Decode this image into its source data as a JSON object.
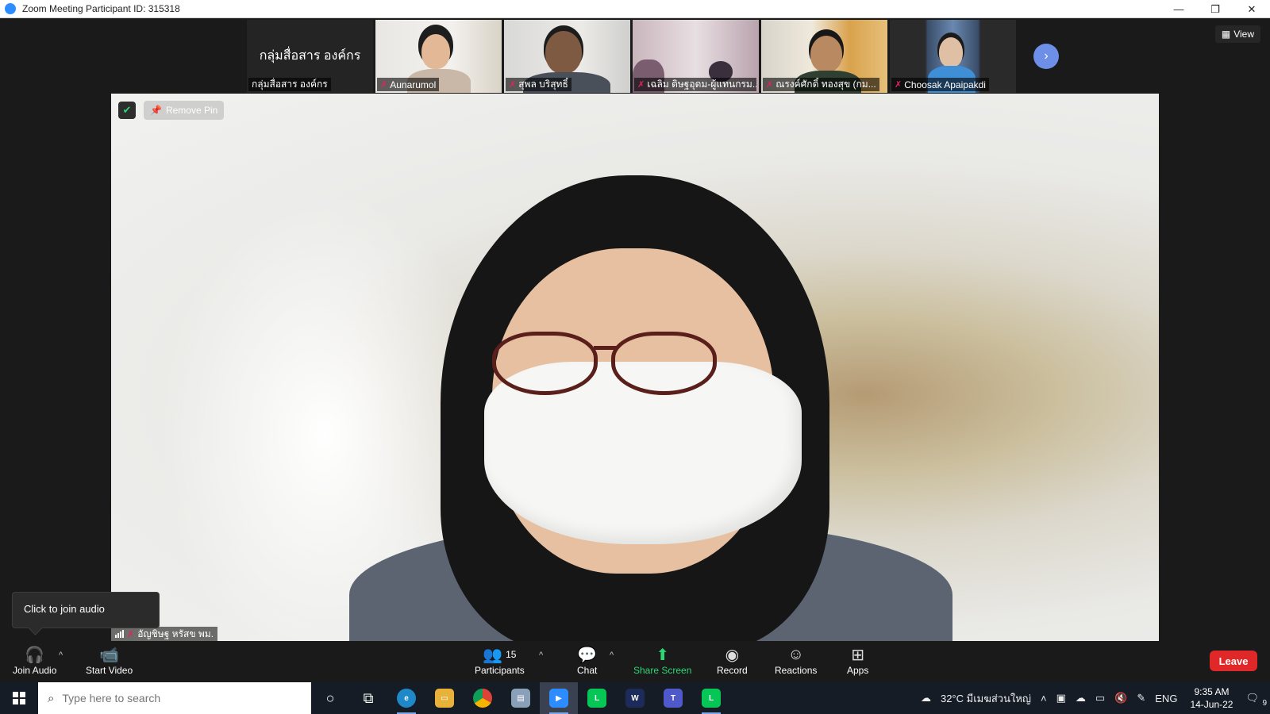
{
  "window": {
    "title": "Zoom Meeting Participant ID: 315318",
    "controls": {
      "minimize": "—",
      "restore": "❐",
      "close": "✕"
    }
  },
  "gallery": {
    "header_tile": {
      "big_text": "กลุ่มสื่อสาร องค์กร",
      "name": "กลุ่มสื่อสาร องค์กร"
    },
    "tiles": [
      {
        "name": "Aunarumol",
        "muted": true
      },
      {
        "name": "สุพล บริสุทธิ์",
        "muted": true
      },
      {
        "name": "เฉลิม ดิษฐอุดม-ผู้แทนกรม...",
        "muted": true
      },
      {
        "name": "ณรงค์ศักดิ์ ทองสุข (กม...",
        "muted": true
      },
      {
        "name": "Choosak Apaipakdi",
        "muted": true
      }
    ],
    "next_icon": "›",
    "view_label": "View"
  },
  "main": {
    "remove_pin_label": "Remove Pin",
    "participant_name": "อัญชิษฐ หรัสข พม.",
    "tooltip": "Click to join audio"
  },
  "toolbar": {
    "join_audio": "Join Audio",
    "start_video": "Start Video",
    "participants": "Participants",
    "participants_count": "15",
    "chat": "Chat",
    "share_screen": "Share Screen",
    "record": "Record",
    "reactions": "Reactions",
    "apps": "Apps",
    "leave": "Leave",
    "caret": "^"
  },
  "taskbar": {
    "search_placeholder": "Type here to search",
    "weather": "32°C มีเมฆส่วนใหญ่",
    "language": "ENG",
    "time": "9:35 AM",
    "date": "14-Jun-22",
    "notification_count": "9"
  },
  "colors": {
    "accent_green": "#2ed573",
    "leave_red": "#e02828",
    "mute_red": "#e0245e",
    "zoom_blue": "#2d8cff"
  }
}
